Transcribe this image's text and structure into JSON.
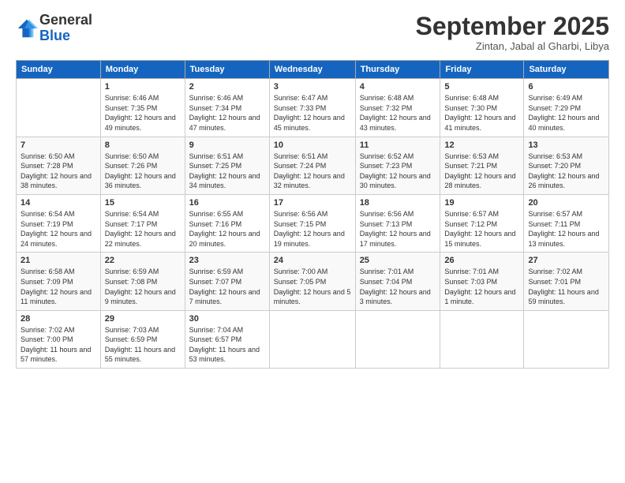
{
  "logo": {
    "general": "General",
    "blue": "Blue"
  },
  "title": "September 2025",
  "location": "Zintan, Jabal al Gharbi, Libya",
  "days_of_week": [
    "Sunday",
    "Monday",
    "Tuesday",
    "Wednesday",
    "Thursday",
    "Friday",
    "Saturday"
  ],
  "weeks": [
    [
      {
        "day": "",
        "sunrise": "",
        "sunset": "",
        "daylight": ""
      },
      {
        "day": "1",
        "sunrise": "6:46 AM",
        "sunset": "7:35 PM",
        "daylight": "12 hours and 49 minutes."
      },
      {
        "day": "2",
        "sunrise": "6:46 AM",
        "sunset": "7:34 PM",
        "daylight": "12 hours and 47 minutes."
      },
      {
        "day": "3",
        "sunrise": "6:47 AM",
        "sunset": "7:33 PM",
        "daylight": "12 hours and 45 minutes."
      },
      {
        "day": "4",
        "sunrise": "6:48 AM",
        "sunset": "7:32 PM",
        "daylight": "12 hours and 43 minutes."
      },
      {
        "day": "5",
        "sunrise": "6:48 AM",
        "sunset": "7:30 PM",
        "daylight": "12 hours and 41 minutes."
      },
      {
        "day": "6",
        "sunrise": "6:49 AM",
        "sunset": "7:29 PM",
        "daylight": "12 hours and 40 minutes."
      }
    ],
    [
      {
        "day": "7",
        "sunrise": "6:50 AM",
        "sunset": "7:28 PM",
        "daylight": "12 hours and 38 minutes."
      },
      {
        "day": "8",
        "sunrise": "6:50 AM",
        "sunset": "7:26 PM",
        "daylight": "12 hours and 36 minutes."
      },
      {
        "day": "9",
        "sunrise": "6:51 AM",
        "sunset": "7:25 PM",
        "daylight": "12 hours and 34 minutes."
      },
      {
        "day": "10",
        "sunrise": "6:51 AM",
        "sunset": "7:24 PM",
        "daylight": "12 hours and 32 minutes."
      },
      {
        "day": "11",
        "sunrise": "6:52 AM",
        "sunset": "7:23 PM",
        "daylight": "12 hours and 30 minutes."
      },
      {
        "day": "12",
        "sunrise": "6:53 AM",
        "sunset": "7:21 PM",
        "daylight": "12 hours and 28 minutes."
      },
      {
        "day": "13",
        "sunrise": "6:53 AM",
        "sunset": "7:20 PM",
        "daylight": "12 hours and 26 minutes."
      }
    ],
    [
      {
        "day": "14",
        "sunrise": "6:54 AM",
        "sunset": "7:19 PM",
        "daylight": "12 hours and 24 minutes."
      },
      {
        "day": "15",
        "sunrise": "6:54 AM",
        "sunset": "7:17 PM",
        "daylight": "12 hours and 22 minutes."
      },
      {
        "day": "16",
        "sunrise": "6:55 AM",
        "sunset": "7:16 PM",
        "daylight": "12 hours and 20 minutes."
      },
      {
        "day": "17",
        "sunrise": "6:56 AM",
        "sunset": "7:15 PM",
        "daylight": "12 hours and 19 minutes."
      },
      {
        "day": "18",
        "sunrise": "6:56 AM",
        "sunset": "7:13 PM",
        "daylight": "12 hours and 17 minutes."
      },
      {
        "day": "19",
        "sunrise": "6:57 AM",
        "sunset": "7:12 PM",
        "daylight": "12 hours and 15 minutes."
      },
      {
        "day": "20",
        "sunrise": "6:57 AM",
        "sunset": "7:11 PM",
        "daylight": "12 hours and 13 minutes."
      }
    ],
    [
      {
        "day": "21",
        "sunrise": "6:58 AM",
        "sunset": "7:09 PM",
        "daylight": "12 hours and 11 minutes."
      },
      {
        "day": "22",
        "sunrise": "6:59 AM",
        "sunset": "7:08 PM",
        "daylight": "12 hours and 9 minutes."
      },
      {
        "day": "23",
        "sunrise": "6:59 AM",
        "sunset": "7:07 PM",
        "daylight": "12 hours and 7 minutes."
      },
      {
        "day": "24",
        "sunrise": "7:00 AM",
        "sunset": "7:05 PM",
        "daylight": "12 hours and 5 minutes."
      },
      {
        "day": "25",
        "sunrise": "7:01 AM",
        "sunset": "7:04 PM",
        "daylight": "12 hours and 3 minutes."
      },
      {
        "day": "26",
        "sunrise": "7:01 AM",
        "sunset": "7:03 PM",
        "daylight": "12 hours and 1 minute."
      },
      {
        "day": "27",
        "sunrise": "7:02 AM",
        "sunset": "7:01 PM",
        "daylight": "11 hours and 59 minutes."
      }
    ],
    [
      {
        "day": "28",
        "sunrise": "7:02 AM",
        "sunset": "7:00 PM",
        "daylight": "11 hours and 57 minutes."
      },
      {
        "day": "29",
        "sunrise": "7:03 AM",
        "sunset": "6:59 PM",
        "daylight": "11 hours and 55 minutes."
      },
      {
        "day": "30",
        "sunrise": "7:04 AM",
        "sunset": "6:57 PM",
        "daylight": "11 hours and 53 minutes."
      },
      {
        "day": "",
        "sunrise": "",
        "sunset": "",
        "daylight": ""
      },
      {
        "day": "",
        "sunrise": "",
        "sunset": "",
        "daylight": ""
      },
      {
        "day": "",
        "sunrise": "",
        "sunset": "",
        "daylight": ""
      },
      {
        "day": "",
        "sunrise": "",
        "sunset": "",
        "daylight": ""
      }
    ]
  ]
}
